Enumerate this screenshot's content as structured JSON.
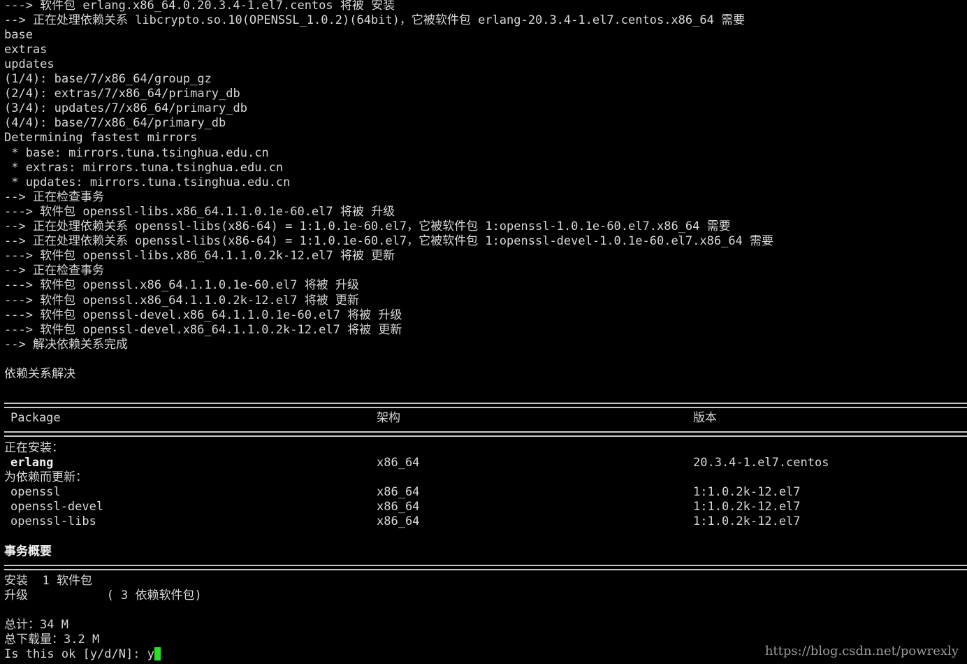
{
  "log_lines": [
    "---> 软件包 erlang.x86_64.0.20.3.4-1.el7.centos 将被 安装",
    "--> 正在处理依赖关系 libcrypto.so.10(OPENSSL_1.0.2)(64bit)，它被软件包 erlang-20.3.4-1.el7.centos.x86_64 需要",
    "base",
    "extras",
    "updates",
    "(1/4): base/7/x86_64/group_gz",
    "(2/4): extras/7/x86_64/primary_db",
    "(3/4): updates/7/x86_64/primary_db",
    "(4/4): base/7/x86_64/primary_db",
    "Determining fastest mirrors",
    " * base: mirrors.tuna.tsinghua.edu.cn",
    " * extras: mirrors.tuna.tsinghua.edu.cn",
    " * updates: mirrors.tuna.tsinghua.edu.cn",
    "--> 正在检查事务",
    "---> 软件包 openssl-libs.x86_64.1.1.0.1e-60.el7 将被 升级",
    "--> 正在处理依赖关系 openssl-libs(x86-64) = 1:1.0.1e-60.el7，它被软件包 1:openssl-1.0.1e-60.el7.x86_64 需要",
    "--> 正在处理依赖关系 openssl-libs(x86-64) = 1:1.0.1e-60.el7，它被软件包 1:openssl-devel-1.0.1e-60.el7.x86_64 需要",
    "---> 软件包 openssl-libs.x86_64.1.1.0.2k-12.el7 将被 更新",
    "--> 正在检查事务",
    "---> 软件包 openssl.x86_64.1.1.0.1e-60.el7 将被 升级",
    "---> 软件包 openssl.x86_64.1.1.0.2k-12.el7 将被 更新",
    "---> 软件包 openssl-devel.x86_64.1.1.0.1e-60.el7 将被 升级",
    "---> 软件包 openssl-devel.x86_64.1.1.0.2k-12.el7 将被 更新",
    "--> 解决依赖关系完成"
  ],
  "resolved_text": "依赖关系解决",
  "table": {
    "headers": {
      "package": "Package",
      "arch": "架构",
      "version": "版本"
    },
    "installing_label": "正在安装：",
    "installing": [
      {
        "name": "erlang",
        "arch": "x86_64",
        "version": "20.3.4-1.el7.centos"
      }
    ],
    "updating_label": "为依赖而更新：",
    "updating": [
      {
        "name": "openssl",
        "arch": "x86_64",
        "version": "1:1.0.2k-12.el7"
      },
      {
        "name": "openssl-devel",
        "arch": "x86_64",
        "version": "1:1.0.2k-12.el7"
      },
      {
        "name": "openssl-libs",
        "arch": "x86_64",
        "version": "1:1.0.2k-12.el7"
      }
    ]
  },
  "summary": {
    "title": "事务概要",
    "install_line": "安装  1 软件包",
    "upgrade_line": "升级           ( 3 依赖软件包)",
    "total_line": "总计：34 M",
    "download_line": "总下载量：3.2 M",
    "prompt": "Is this ok [y/d/N]: ",
    "input_value": "y"
  },
  "watermark": "https://blog.csdn.net/powrexly",
  "colors": {
    "background": "#000000",
    "foreground": "#d8d8d8",
    "cursor": "#28e028"
  }
}
